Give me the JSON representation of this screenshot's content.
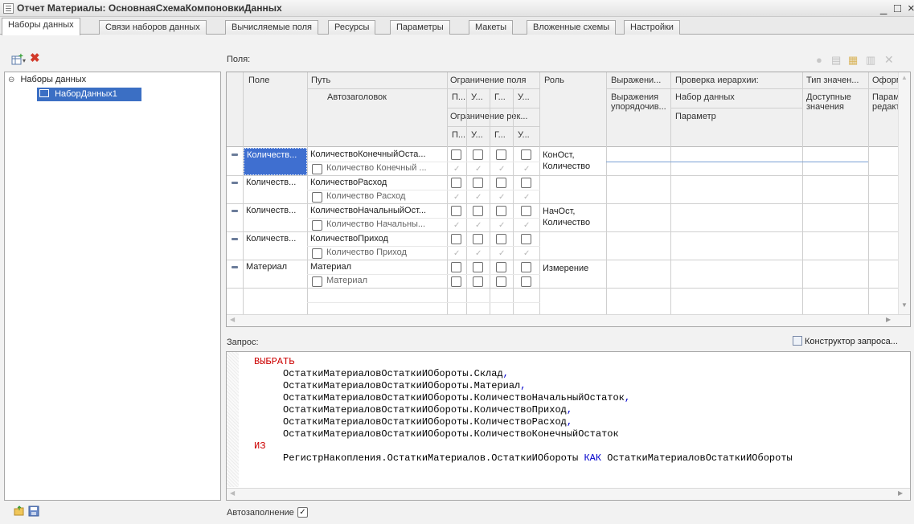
{
  "window": {
    "title": "Отчет Материалы: ОсновнаяСхемаКомпоновкиДанных",
    "minimize": "_",
    "maximize": "□",
    "close": "×"
  },
  "tabs": [
    "Наборы данных",
    "Связи наборов данных",
    "Вычисляемые поля",
    "Ресурсы",
    "Параметры",
    "Макеты",
    "Вложенные схемы",
    "Настройки"
  ],
  "tree": {
    "root": "Наборы данных",
    "child": "НаборДанных1"
  },
  "fields": {
    "label": "Поля:",
    "headers": {
      "field": "Поле",
      "path": "Путь",
      "autotitle": "Автозаголовок",
      "restrict": "Ограничение поля",
      "restrict_sub": [
        "П...",
        "У...",
        "Г...",
        "У..."
      ],
      "restrict_req": "Ограничение рек...",
      "restrict_req_sub": [
        "П...",
        "У...",
        "Г...",
        "У..."
      ],
      "role": "Роль",
      "expr": "Выражени...",
      "expr_order": "Выражения упорядочив...",
      "hier": "Проверка иерархии:",
      "hier_set": "Набор данных",
      "hier_param": "Параметр",
      "type": "Тип значен...",
      "avail": "Доступные значения",
      "format": "Оформ",
      "format_sub": "Парам редакт"
    },
    "rows": [
      {
        "field": "Количеств...",
        "path": "КоличествоКонечныйОста...",
        "title": "Количество Конечный ...",
        "role": "КонОст, Количество",
        "selected": true
      },
      {
        "field": "Количеств...",
        "path": "КоличествоРасход",
        "title": "Количество Расход",
        "role": ""
      },
      {
        "field": "Количеств...",
        "path": "КоличествоНачальныйОст...",
        "title": "Количество Начальны...",
        "role": "НачОст, Количество"
      },
      {
        "field": "Количеств...",
        "path": "КоличествоПриход",
        "title": "Количество Приход",
        "role": ""
      },
      {
        "field": "Материал",
        "path": "Материал",
        "title": "Материал",
        "role": "Измерение"
      }
    ]
  },
  "query": {
    "label": "Запрос:",
    "constructor": "Конструктор запроса...",
    "select_kw": "ВЫБРАТЬ",
    "lines": [
      "ОстаткиМатериаловОстаткиИОбороты.Склад",
      "ОстаткиМатериаловОстаткиИОбороты.Материал",
      "ОстаткиМатериаловОстаткиИОбороты.КоличествоНачальныйОстаток",
      "ОстаткиМатериаловОстаткиИОбороты.КоличествоПриход",
      "ОстаткиМатериаловОстаткиИОбороты.КоличествоРасход",
      "ОстаткиМатериаловОстаткиИОбороты.КоличествоКонечныйОстаток"
    ],
    "from_kw": "ИЗ",
    "from_source": "РегистрНакопления.ОстаткиМатериалов.ОстаткиИОбороты",
    "as_kw": "КАК",
    "alias": "ОстаткиМатериаловОстаткиИОбороты"
  },
  "autofill": "Автозаполнение",
  "icons": [
    "add-icon",
    "delete-icon",
    "green-circle-icon",
    "copy-icon",
    "add-field-icon",
    "folder-icon",
    "save-icon"
  ]
}
